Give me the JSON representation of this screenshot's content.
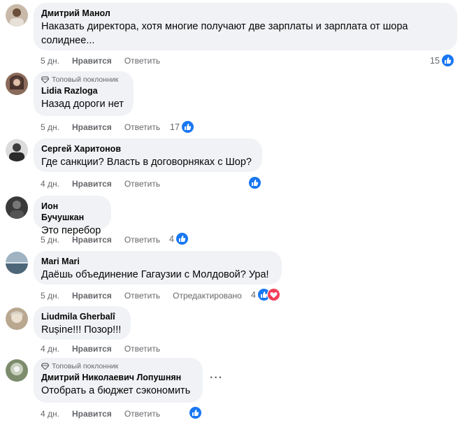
{
  "comments": [
    {
      "author": "Дмитрий Манол",
      "badge": "",
      "text": [
        "Наказать директора, хотя многие получают две зарплаты и зарплата от шора",
        "солиднее..."
      ],
      "time": "5 дн.",
      "like": "Нравится",
      "reply": "Ответить",
      "edited": "",
      "reactions": "15",
      "icons": [
        "like-icon"
      ]
    },
    {
      "author": "Lidia Razloga",
      "badge": "Топовый поклонник",
      "text": [
        "Назад дороги нет"
      ],
      "time": "5 дн.",
      "like": "Нравится",
      "reply": "Ответить",
      "edited": "",
      "reactions": "17",
      "icons": [
        "like-icon"
      ]
    },
    {
      "author": "Сергей Харитонов",
      "badge": "",
      "text": [
        "Где санкции? Власть в договорняках с Шор?"
      ],
      "time": "4 дн.",
      "like": "Нравится",
      "reply": "Ответить",
      "edited": "",
      "reactions": "",
      "icons": [
        "like-icon"
      ]
    },
    {
      "author": "Ион Бучушкан",
      "badge": "",
      "text": [
        "Это перебор"
      ],
      "time": "5 дн.",
      "like": "Нравится",
      "reply": "Ответить",
      "edited": "",
      "reactions": "4",
      "icons": [
        "like-icon"
      ]
    },
    {
      "author": "Mari Mari",
      "badge": "",
      "text": [
        "Даёшь объединение Гагаузии с Молдовой? Ура!"
      ],
      "time": "5 дн.",
      "like": "Нравится",
      "reply": "Ответить",
      "edited": "Отредактировано",
      "reactions": "4",
      "icons": [
        "like-icon",
        "heart-icon"
      ]
    },
    {
      "author": "Liudmila Gherbalî",
      "badge": "",
      "text": [
        "Rușine!!! Позор!!!"
      ],
      "time": "4 дн.",
      "like": "Нравится",
      "reply": "Ответить",
      "edited": "",
      "reactions": "",
      "icons": []
    },
    {
      "author": "Дмитрий Николаевич Лопушнян",
      "badge": "Топовый поклонник",
      "text": [
        "Отобрать а бюджет сэкономить"
      ],
      "time": "4 дн.",
      "like": "Нравится",
      "reply": "Ответить",
      "edited": "",
      "reactions": "",
      "icons": [
        "like-icon"
      ]
    }
  ],
  "more_options_label": "···",
  "colors": {
    "accent": "#1877f2",
    "heart": "#f33e58",
    "bubble": "#f0f2f5",
    "muted": "#65676b"
  }
}
